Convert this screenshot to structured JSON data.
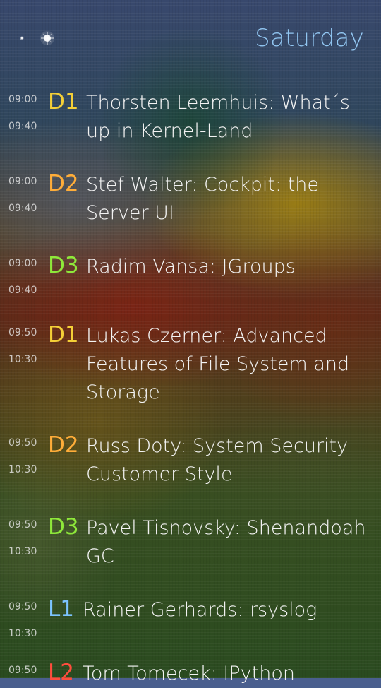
{
  "header": {
    "title": "Saturday",
    "accent": "#91c6f1"
  },
  "schedule": [
    {
      "start": "09:00",
      "end": "09:40",
      "room": "D1",
      "room_color": "#f4cf37",
      "title": "Thorsten Leemhuis: What´s up in Kernel-Land"
    },
    {
      "start": "09:00",
      "end": "09:40",
      "room": "D2",
      "room_color": "#ffad39",
      "title": "Stef Walter: Cockpit: the Server UI"
    },
    {
      "start": "09:00",
      "end": "09:40",
      "room": "D3",
      "room_color": "#8ee83a",
      "title": "Radim Vansa: JGroups"
    },
    {
      "start": "09:50",
      "end": "10:30",
      "room": "D1",
      "room_color": "#f4cf37",
      "title": "Lukas Czerner: Advanced Features of File System and Storage"
    },
    {
      "start": "09:50",
      "end": "10:30",
      "room": "D2",
      "room_color": "#ffad39",
      "title": "Russ Doty: System Security Customer Style"
    },
    {
      "start": "09:50",
      "end": "10:30",
      "room": "D3",
      "room_color": "#8ee83a",
      "title": "Pavel Tisnovsky: Shenandoah GC"
    },
    {
      "start": "09:50",
      "end": "10:30",
      "room": "L1",
      "room_color": "#7cc4ff",
      "title": "Rainer Gerhards: rsyslog"
    },
    {
      "start": "09:50",
      "end": "",
      "room": "L2",
      "room_color": "#ff4d3d",
      "title": "Tom Tomecek: IPython"
    }
  ],
  "icons": {
    "page_indicator": "page-indicator-icon"
  }
}
